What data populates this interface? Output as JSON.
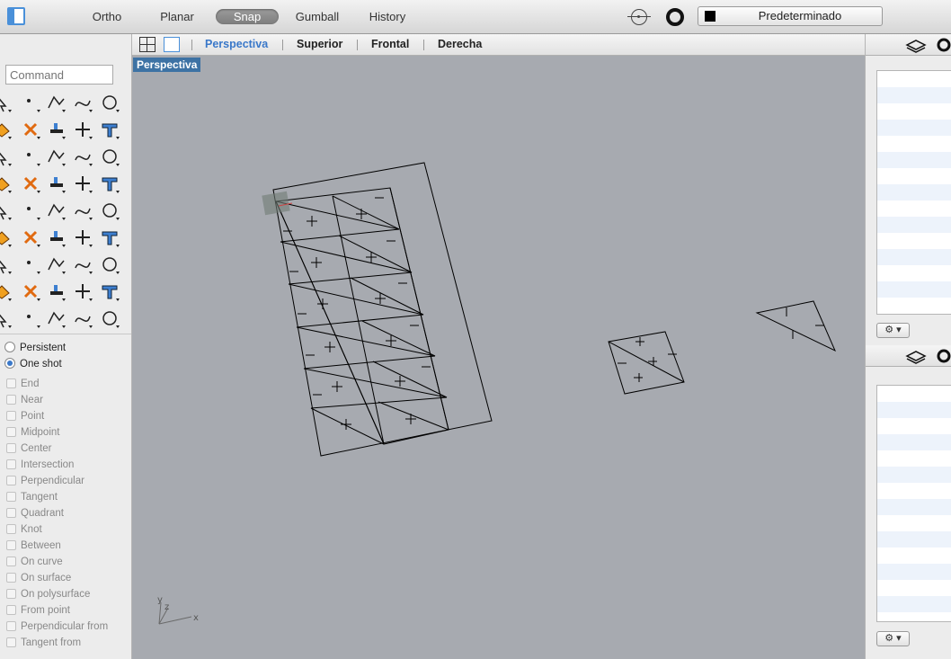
{
  "toolbar": {
    "modes": [
      {
        "label": "Ortho",
        "active": false
      },
      {
        "label": "Planar",
        "active": false
      },
      {
        "label": "Snap",
        "active": true
      },
      {
        "label": "Gumball",
        "active": false
      },
      {
        "label": "History",
        "active": false
      }
    ],
    "layer": {
      "name": "Predeterminado",
      "color": "#000000"
    }
  },
  "viewport_tabs": {
    "tabs": [
      {
        "label": "Perspectiva",
        "active": true
      },
      {
        "label": "Superior",
        "active": false
      },
      {
        "label": "Frontal",
        "active": false
      },
      {
        "label": "Derecha",
        "active": false
      }
    ]
  },
  "viewport": {
    "label": "Perspectiva",
    "background": "#a7aab0",
    "axis_labels": {
      "x": "x",
      "y": "y",
      "z": "z"
    }
  },
  "command": {
    "placeholder": "Command",
    "value": ""
  },
  "tool_icons": [
    "select-arrow-icon",
    "point-icon",
    "polyline-icon",
    "curve-icon",
    "circle-icon",
    "arc-icon",
    "freeform-curve-icon",
    "rectangle-icon",
    "polygon-icon",
    "fillet-icon",
    "surface-icon",
    "sweep-icon",
    "box-icon",
    "sphere-icon",
    "cylinder-icon",
    "extrude-icon",
    "explode-icon",
    "boolean-icon",
    "split-icon",
    "trim-icon",
    "solid-union-icon",
    "points-icon",
    "rotate-icon",
    "offset-icon",
    "text-icon",
    "transform-icon",
    "group-icon",
    "edit-icon",
    "block-icon",
    "dimension-icon",
    "array-icon",
    "move-icon",
    "mirror-icon",
    "check-icon",
    "analyze-icon",
    "edit-points-icon",
    "zoom-icon",
    "zoom-window-icon",
    "zoom-extents-icon",
    "zoom-selected-icon",
    "rotate-view-icon",
    "car-render-icon",
    "texture-icon",
    "shapes-icon",
    "light-bulb-icon"
  ],
  "osnap_mode": {
    "options": [
      {
        "label": "Persistent",
        "selected": false
      },
      {
        "label": "One shot",
        "selected": true
      }
    ],
    "snaps": [
      "End",
      "Near",
      "Point",
      "Midpoint",
      "Center",
      "Intersection",
      "Perpendicular",
      "Tangent",
      "Quadrant",
      "Knot",
      "Between",
      "On curve",
      "On surface",
      "On polysurface",
      "From point",
      "Perpendicular from",
      "Tangent from"
    ]
  },
  "right_panel": {
    "gear_label": "⚙ ▾"
  }
}
